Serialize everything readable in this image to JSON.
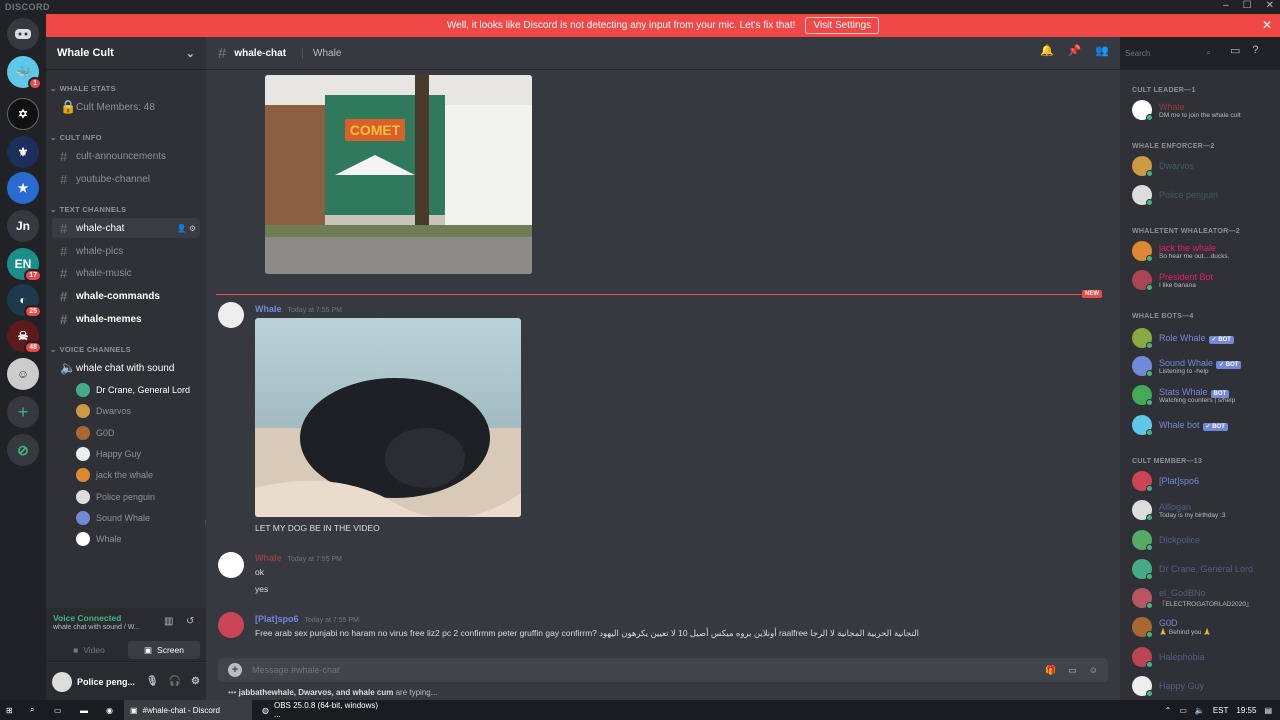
{
  "app": {
    "title": "DISCORD"
  },
  "notice": {
    "text": "Well, it looks like Discord is not detecting any input from your mic. Let's fix that!",
    "button": "Visit Settings"
  },
  "server": {
    "name": "Whale Cult"
  },
  "guild_badges": {
    "g1": "1",
    "g8": "17",
    "g10": "25",
    "g11": "48"
  },
  "guild_jn": "Jn",
  "guild_en": "EN",
  "categories": {
    "stats": "WHALE STATS",
    "info": "CULT INFO",
    "text": "TEXT CHANNELS",
    "voice": "VOICE CHANNELS"
  },
  "channels": {
    "members_count": "Cult Members: 48",
    "announcements": "cult-announcements",
    "youtube": "youtube-channel",
    "chat": "whale-chat",
    "pics": "whale-pics",
    "music": "whale-music",
    "commands": "whale-commands",
    "memes": "whale-memes",
    "voice_chat": "whale chat with sound"
  },
  "voice_users": [
    "Dr Crane, General Lord",
    "Dwarvos",
    "G0D",
    "Happy Guy",
    "jack the whale",
    "Police penguin",
    "Sound Whale",
    "Whale"
  ],
  "voice_panel": {
    "title": "Voice Connected",
    "sub": "whale chat with sound / W...",
    "video": "Video",
    "screen": "Screen"
  },
  "user_panel": {
    "name": "Police peng..."
  },
  "header": {
    "channel": "whale-chat",
    "topic": "Whale",
    "search": "Search"
  },
  "divider": {
    "tag": "NEW"
  },
  "messages": {
    "m1": {
      "author": "Whale",
      "time": "Today at 7:55 PM",
      "text": "LET MY DOG BE IN THE VIDEO"
    },
    "m2": {
      "author": "Whale",
      "time": "Today at 7:55 PM",
      "line1": "ok",
      "line2": "yes"
    },
    "m3": {
      "author": "[Plat]spo6",
      "time": "Today at 7:55 PM",
      "text": "Free arab sex punjabi no haram no virus free liz2 pc 2 confirmm peter gruffin gay confirrm?  أونلاين بروه ميكس أصيل 10 لا تعيين يكرهون اليهود raalfree التجانية الحربية المجانية لا الرجا"
    }
  },
  "composer": {
    "placeholder": "Message #whale-chat"
  },
  "typing": {
    "names": "jabbathewhale, Dwarvos, and whale cum",
    "suffix": "are typing..."
  },
  "member_list": {
    "leader_cat": "CULT LEADER—1",
    "leader": {
      "name": "Whale",
      "sub": "DM me to join the whale cult"
    },
    "enforcer_cat": "WHALE ENFORCER—2",
    "enforcer1": "Dwarvos",
    "enforcer2": "Police penguin",
    "whaletent_cat": "WHALETENT WHALEATOR—2",
    "wt1": {
      "name": "jack the whale",
      "sub": "So hear me out....ducks."
    },
    "wt2": {
      "name": "President Bot",
      "sub": "I like banana"
    },
    "bots_cat": "WHALE BOTS—4",
    "bot1": {
      "name": "Role Whale",
      "tag": "✓ BOT"
    },
    "bot2": {
      "name": "Sound Whale",
      "tag": "✓ BOT",
      "sub": "Listening to -help"
    },
    "bot3": {
      "name": "Stats Whale",
      "tag": "BOT",
      "sub": "Watching counters | s/help"
    },
    "bot4": {
      "name": "Whale bot",
      "tag": "✓ BOT"
    },
    "cm_cat": "CULT MEMBER—13",
    "cm1": "[Plat]spo6",
    "cm2": {
      "name": "Alllogan",
      "sub": "Today is my birthday :3"
    },
    "cm3": "Dickpolice",
    "cm4": "Dr Crane, General Lord",
    "cm5": {
      "name": "el_GodBNo",
      "sub": "『ELECTROGATORLAD2020』"
    },
    "cm6": {
      "name": "G0D",
      "sub": "🙏 Behind you 🙏"
    },
    "cm7": "Halephobia",
    "cm8": "Happy Guy"
  },
  "taskbar": {
    "item1": "#whale-chat - Discord",
    "item2": "OBS 25.0.8 (64-bit, windows) ...",
    "lang": "EST",
    "time": "19:55"
  },
  "colors": {
    "accent": "#7289da",
    "danger": "#f04747",
    "online": "#43b581"
  }
}
